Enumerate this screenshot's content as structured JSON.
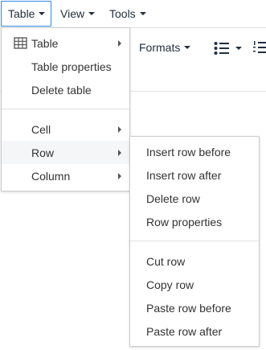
{
  "menubar": {
    "items": [
      {
        "label": "Table",
        "active": true
      },
      {
        "label": "View",
        "active": false
      },
      {
        "label": "Tools",
        "active": false
      }
    ]
  },
  "toolbar": {
    "formats_label": "Formats"
  },
  "table_menu": {
    "items": [
      {
        "label": "Table",
        "icon": "table-grid-icon",
        "has_submenu": true
      },
      {
        "label": "Table properties",
        "has_submenu": false
      },
      {
        "label": "Delete table",
        "has_submenu": false
      },
      {
        "label": "Cell",
        "has_submenu": true
      },
      {
        "label": "Row",
        "has_submenu": true,
        "highlighted": true
      },
      {
        "label": "Column",
        "has_submenu": true
      }
    ]
  },
  "row_menu": {
    "items": [
      {
        "label": "Insert row before"
      },
      {
        "label": "Insert row after"
      },
      {
        "label": "Delete row"
      },
      {
        "label": "Row properties"
      },
      {
        "label": "Cut row"
      },
      {
        "label": "Copy row"
      },
      {
        "label": "Paste row before"
      },
      {
        "label": "Paste row after"
      }
    ]
  },
  "colors": {
    "accent_border": "#2d8ae6",
    "highlight_bg": "#f4f6f8",
    "menu_border": "#cccccc",
    "text": "#333333"
  }
}
